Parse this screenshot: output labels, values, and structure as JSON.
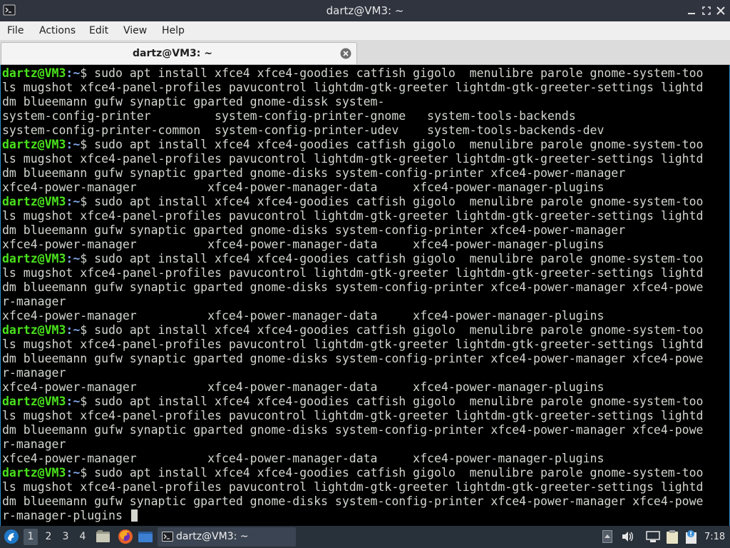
{
  "window": {
    "title": "dartz@VM3: ~"
  },
  "menu": {
    "items": [
      "File",
      "Actions",
      "Edit",
      "View",
      "Help"
    ]
  },
  "tabs": [
    {
      "label": "dartz@VM3: ~"
    }
  ],
  "terminal": {
    "prompt_user": "dartz@VM3",
    "prompt_path": ":~",
    "prompt_symbol": "$",
    "lines": [
      {
        "p": true,
        "t": " sudo apt install xfce4 xfce4-goodies catfish gigolo  menulibre parole gnome-system-too"
      },
      {
        "p": false,
        "t": "ls mugshot xfce4-panel-profiles pavucontrol lightdm-gtk-greeter lightdm-gtk-greeter-settings lightd"
      },
      {
        "p": false,
        "t": "dm blueemann gufw synaptic gparted gnome-dissk system-"
      },
      {
        "p": false,
        "t": "system-config-printer         system-config-printer-gnome   system-tools-backends"
      },
      {
        "p": false,
        "t": "system-config-printer-common  system-config-printer-udev    system-tools-backends-dev"
      },
      {
        "p": true,
        "t": " sudo apt install xfce4 xfce4-goodies catfish gigolo  menulibre parole gnome-system-too"
      },
      {
        "p": false,
        "t": "ls mugshot xfce4-panel-profiles pavucontrol lightdm-gtk-greeter lightdm-gtk-greeter-settings lightd"
      },
      {
        "p": false,
        "t": "dm blueemann gufw synaptic gparted gnome-disks system-config-printer xfce4-power-manager"
      },
      {
        "p": false,
        "t": "xfce4-power-manager          xfce4-power-manager-data     xfce4-power-manager-plugins"
      },
      {
        "p": true,
        "t": " sudo apt install xfce4 xfce4-goodies catfish gigolo  menulibre parole gnome-system-too"
      },
      {
        "p": false,
        "t": "ls mugshot xfce4-panel-profiles pavucontrol lightdm-gtk-greeter lightdm-gtk-greeter-settings lightd"
      },
      {
        "p": false,
        "t": "dm blueemann gufw synaptic gparted gnome-disks system-config-printer xfce4-power-manager"
      },
      {
        "p": false,
        "t": "xfce4-power-manager          xfce4-power-manager-data     xfce4-power-manager-plugins"
      },
      {
        "p": true,
        "t": " sudo apt install xfce4 xfce4-goodies catfish gigolo  menulibre parole gnome-system-too"
      },
      {
        "p": false,
        "t": "ls mugshot xfce4-panel-profiles pavucontrol lightdm-gtk-greeter lightdm-gtk-greeter-settings lightd"
      },
      {
        "p": false,
        "t": "dm blueemann gufw synaptic gparted gnome-disks system-config-printer xfce4-power-manager xfce4-powe"
      },
      {
        "p": false,
        "t": "r-manager"
      },
      {
        "p": false,
        "t": "xfce4-power-manager          xfce4-power-manager-data     xfce4-power-manager-plugins"
      },
      {
        "p": true,
        "t": " sudo apt install xfce4 xfce4-goodies catfish gigolo  menulibre parole gnome-system-too"
      },
      {
        "p": false,
        "t": "ls mugshot xfce4-panel-profiles pavucontrol lightdm-gtk-greeter lightdm-gtk-greeter-settings lightd"
      },
      {
        "p": false,
        "t": "dm blueemann gufw synaptic gparted gnome-disks system-config-printer xfce4-power-manager xfce4-powe"
      },
      {
        "p": false,
        "t": "r-manager"
      },
      {
        "p": false,
        "t": "xfce4-power-manager          xfce4-power-manager-data     xfce4-power-manager-plugins"
      },
      {
        "p": true,
        "t": " sudo apt install xfce4 xfce4-goodies catfish gigolo  menulibre parole gnome-system-too"
      },
      {
        "p": false,
        "t": "ls mugshot xfce4-panel-profiles pavucontrol lightdm-gtk-greeter lightdm-gtk-greeter-settings lightd"
      },
      {
        "p": false,
        "t": "dm blueemann gufw synaptic gparted gnome-disks system-config-printer xfce4-power-manager xfce4-powe"
      },
      {
        "p": false,
        "t": "r-manager"
      },
      {
        "p": false,
        "t": "xfce4-power-manager          xfce4-power-manager-data     xfce4-power-manager-plugins"
      },
      {
        "p": true,
        "t": " sudo apt install xfce4 xfce4-goodies catfish gigolo  menulibre parole gnome-system-too"
      },
      {
        "p": false,
        "t": "ls mugshot xfce4-panel-profiles pavucontrol lightdm-gtk-greeter lightdm-gtk-greeter-settings lightd"
      },
      {
        "p": false,
        "t": "dm blueemann gufw synaptic gparted gnome-disks system-config-printer xfce4-power-manager xfce4-powe"
      },
      {
        "p": false,
        "t": "r-manager-plugins ",
        "cursor": true
      }
    ]
  },
  "taskbar": {
    "workspaces": [
      "1",
      "2",
      "3",
      "4"
    ],
    "active_workspace": "1",
    "launchers": [
      "file-manager-icon",
      "firefox-icon",
      "show-desktop-icon"
    ],
    "task_label": "dartz@VM3: ~",
    "clock": "7:18"
  },
  "colors": {
    "prompt_user": "#4ae21c",
    "prompt_path": "#7fa6e6",
    "terminal_bg": "#000000",
    "terminal_fg": "#d3d7cf",
    "titlebar_bg": "#2f343f",
    "taskbar_bg": "#283039"
  }
}
